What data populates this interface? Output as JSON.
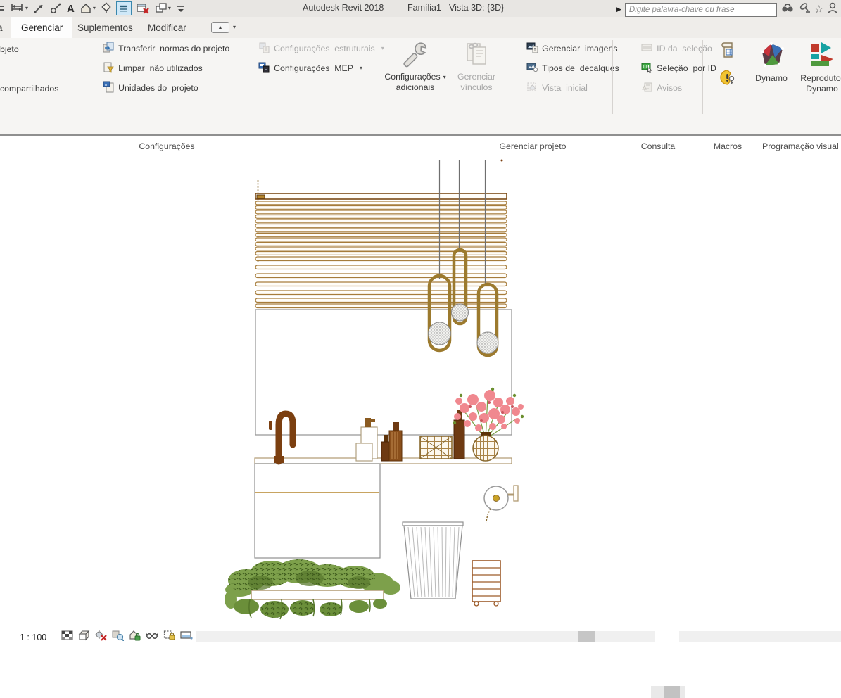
{
  "colors": {
    "titlebar-bg": "#e8e6e3",
    "tabrow-bg": "#efedea",
    "ribbon-bg": "#f6f5f3",
    "text": "#3b3b3b",
    "disabled-text": "#a8a8a8",
    "accent-blue": "#3a87ad",
    "green-icon": "#3faa44",
    "track": "#f0f0f0",
    "thumb": "#c6c6c6",
    "wood": "#a67c3b",
    "wood-dark": "#7b3f10",
    "brass": "#9c7a2e",
    "leaf": "#7da04b",
    "leaf-dark": "#55762a",
    "blossom": "#f0888f",
    "line-gray": "#8f8f8f"
  },
  "titlebar": {
    "app_title": "Autodesk Revit 2018 -",
    "doc_title": "Família1 - Vista 3D: {3D}",
    "search_placeholder": "Digite palavra-chave ou frase"
  },
  "tabs": {
    "clipped": "a",
    "gerenciar": "Gerenciar",
    "suplementos": "Suplementos",
    "modificar": "Modificar"
  },
  "ribbon": {
    "configuracoes": {
      "label": "Configurações",
      "clipped_top": "bjeto",
      "clipped_bottom": "compartilhados",
      "transferir": "Transferir  normas do projeto",
      "limpar": "Limpar  não utilizados",
      "unidades": "Unidades do  projeto",
      "estruturais": "Configurações  estruturais",
      "mep": "Configurações  MEP",
      "adicionais_l1": "Configurações",
      "adicionais_l2": "adicionais"
    },
    "gerenciar_projeto": {
      "label": "Gerenciar projeto",
      "vinculos_l1": "Gerenciar",
      "vinculos_l2": "vínculos",
      "imagens": "Gerenciar  imagens",
      "decalques": "Tipos de  decalques",
      "vista_inicial": "Vista  inicial"
    },
    "consulta": {
      "label": "Consulta",
      "id_selecao": "ID da  seleção",
      "selecao_por_id": "Seleção  por ID",
      "avisos": "Avisos"
    },
    "macros": {
      "label": "Macros"
    },
    "programacao": {
      "label": "Programação visual",
      "dynamo": "Dynamo",
      "reprodutor_l1": "Reprodutor",
      "reprodutor_l2": "Dynamo"
    }
  },
  "viewbar": {
    "scale": "1 : 100",
    "collapse_glyph": "<"
  }
}
